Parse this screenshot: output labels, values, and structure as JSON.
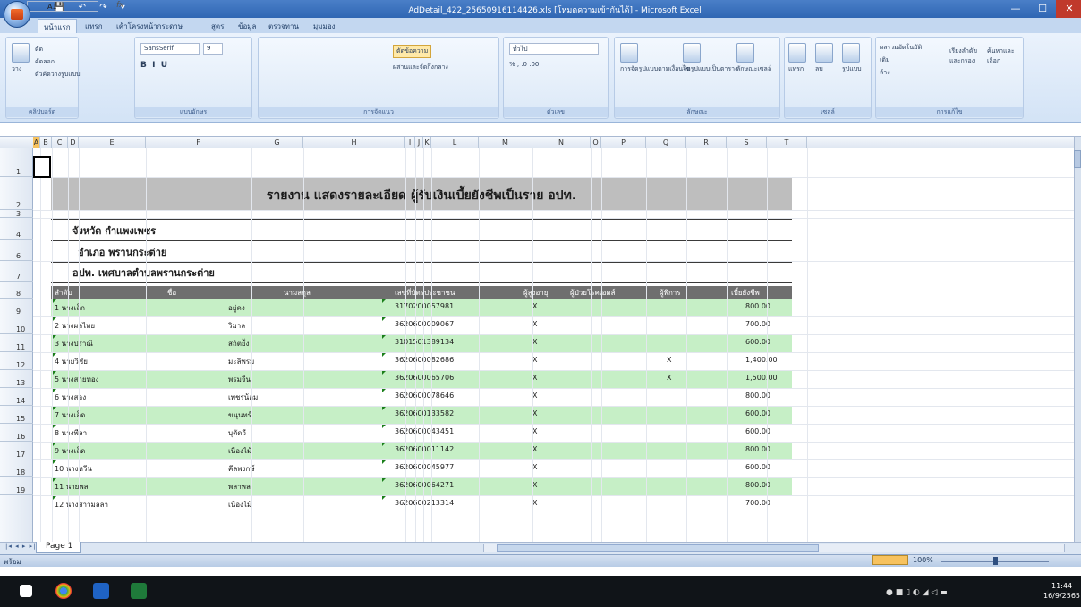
{
  "window": {
    "title": "AdDetail_422_25650916114426.xls [โหมดความเข้ากันได้] - Microsoft Excel",
    "qat_label": "💾 ↶ ↷ ▾",
    "min": "—",
    "max": "☐",
    "close": "✕"
  },
  "tabs": [
    "หน้าแรก",
    "แทรก",
    "เค้าโครงหน้ากระดาษ",
    "สูตร",
    "ข้อมูล",
    "ตรวจทาน",
    "มุมมอง"
  ],
  "ribbon": {
    "clipboard": {
      "label": "คลิปบอร์ด",
      "paste": "วาง",
      "cut": "ตัด",
      "copy": "คัดลอก",
      "format_painter": "ตัวคัดวางรูปแบบ"
    },
    "font": {
      "label": "แบบอักษร",
      "font_name": "SansSerif",
      "font_size": "9"
    },
    "alignment": {
      "label": "การจัดแนว",
      "wrap": "ตัดข้อความ",
      "merge": "ผสานและจัดกึ่งกลาง"
    },
    "number": {
      "label": "ตัวเลข",
      "format": "ทั่วไป"
    },
    "styles": {
      "label": "ลักษณะ",
      "cond": "การจัดรูปแบบตามเงื่อนไข",
      "table": "จัดรูปแบบเป็นตาราง",
      "cell": "ลักษณะเซลล์"
    },
    "cells": {
      "label": "เซลล์",
      "insert": "แทรก",
      "delete": "ลบ",
      "format": "รูปแบบ"
    },
    "editing": {
      "label": "การแก้ไข",
      "autosum": "ผลรวมอัตโนมัติ",
      "fill": "เติม",
      "clear": "ล้าง",
      "sort": "เรียงลำดับ และกรอง",
      "find": "ค้นหาและ เลือก"
    }
  },
  "formula_bar": {
    "name_box": "A1",
    "fx": "fx",
    "value": ""
  },
  "columns": [
    "A",
    "B",
    "C",
    "D",
    "E",
    "F",
    "G",
    "H",
    "I",
    "J",
    "K",
    "L",
    "M",
    "N",
    "O",
    "P",
    "Q",
    "R",
    "S",
    "T"
  ],
  "rows": [
    "1",
    "2",
    "3",
    "4",
    "6",
    "7",
    "8",
    "9",
    "10",
    "11",
    "12",
    "13",
    "14",
    "15",
    "16",
    "17",
    "18",
    "19"
  ],
  "report": {
    "title": "รายงาน แสดงรายละเอียด ผู้รับเงินเบี้ยยังชีพเป็นราย อปท.",
    "province": "จังหวัด กำแพงเพชร",
    "district": "อำเภอ พรานกระต่าย",
    "org": "อปท. เทศบาลตำบลพรานกระต่าย",
    "headers": [
      "ลำดับ",
      "ชื่อ",
      "นามสกุล",
      "เลขที่บัตรประชาชน",
      "ผู้สูงอายุ",
      "ผู้ป่วยโรคเอดส์",
      "ผู้พิการ",
      "เบี้ยยังชีพ"
    ],
    "rows": [
      {
        "no": "1 นางเล็ก",
        "surname": "อยู่คง",
        "id": "3170200057981",
        "elder": "X",
        "aids": "",
        "disabled": "",
        "amount": "800.00"
      },
      {
        "no": "2 นางผลไทย",
        "surname": "วิมาล",
        "id": "3620600009067",
        "elder": "X",
        "aids": "",
        "disabled": "",
        "amount": "700.00"
      },
      {
        "no": "3 นางปราณี",
        "surname": "สถิตย์ัง",
        "id": "3101501389134",
        "elder": "X",
        "aids": "",
        "disabled": "",
        "amount": "600.00"
      },
      {
        "no": "4 นายวิชัย",
        "surname": "มะลิพรม",
        "id": "3620600082686",
        "elder": "X",
        "aids": "",
        "disabled": "X",
        "amount": "1,400.00"
      },
      {
        "no": "5 นางสายทอง",
        "surname": "พรมจีน",
        "id": "3620600065706",
        "elder": "X",
        "aids": "",
        "disabled": "X",
        "amount": "1,500.00"
      },
      {
        "no": "6 นางสอง",
        "surname": "เพชรน้อม",
        "id": "3620600078646",
        "elder": "X",
        "aids": "",
        "disabled": "",
        "amount": "800.00"
      },
      {
        "no": "7 นางเล็ด",
        "surname": "ขนุนทร์",
        "id": "3620600133582",
        "elder": "X",
        "aids": "",
        "disabled": "",
        "amount": "600.00"
      },
      {
        "no": "8 นางพีลา",
        "surname": "บุตัดวี",
        "id": "3620600043451",
        "elder": "X",
        "aids": "",
        "disabled": "",
        "amount": "600.00"
      },
      {
        "no": "9 นางเล็ด",
        "surname": "เนื่องไม้",
        "id": "3620600011142",
        "elder": "X",
        "aids": "",
        "disabled": "",
        "amount": "800.00"
      },
      {
        "no": "10 นางหวีน",
        "surname": "คีลพงกษ์",
        "id": "3620600045977",
        "elder": "X",
        "aids": "",
        "disabled": "",
        "amount": "600.00"
      },
      {
        "no": "11 นายพล",
        "surname": "พลาพล",
        "id": "3620600064271",
        "elder": "X",
        "aids": "",
        "disabled": "",
        "amount": "800.00"
      },
      {
        "no": "12 นางสาวมลลา",
        "surname": "เนื่องไม้",
        "id": "3620600213314",
        "elder": "X",
        "aids": "",
        "disabled": "",
        "amount": "700.00"
      }
    ]
  },
  "sheet": {
    "nav": "|◂ ◂ ▸ ▸|",
    "tab": "Page 1"
  },
  "status": {
    "text": "พร้อม",
    "zoom": "100%"
  },
  "taskbar": {
    "time": "11:44",
    "date": "16/9/2565"
  }
}
